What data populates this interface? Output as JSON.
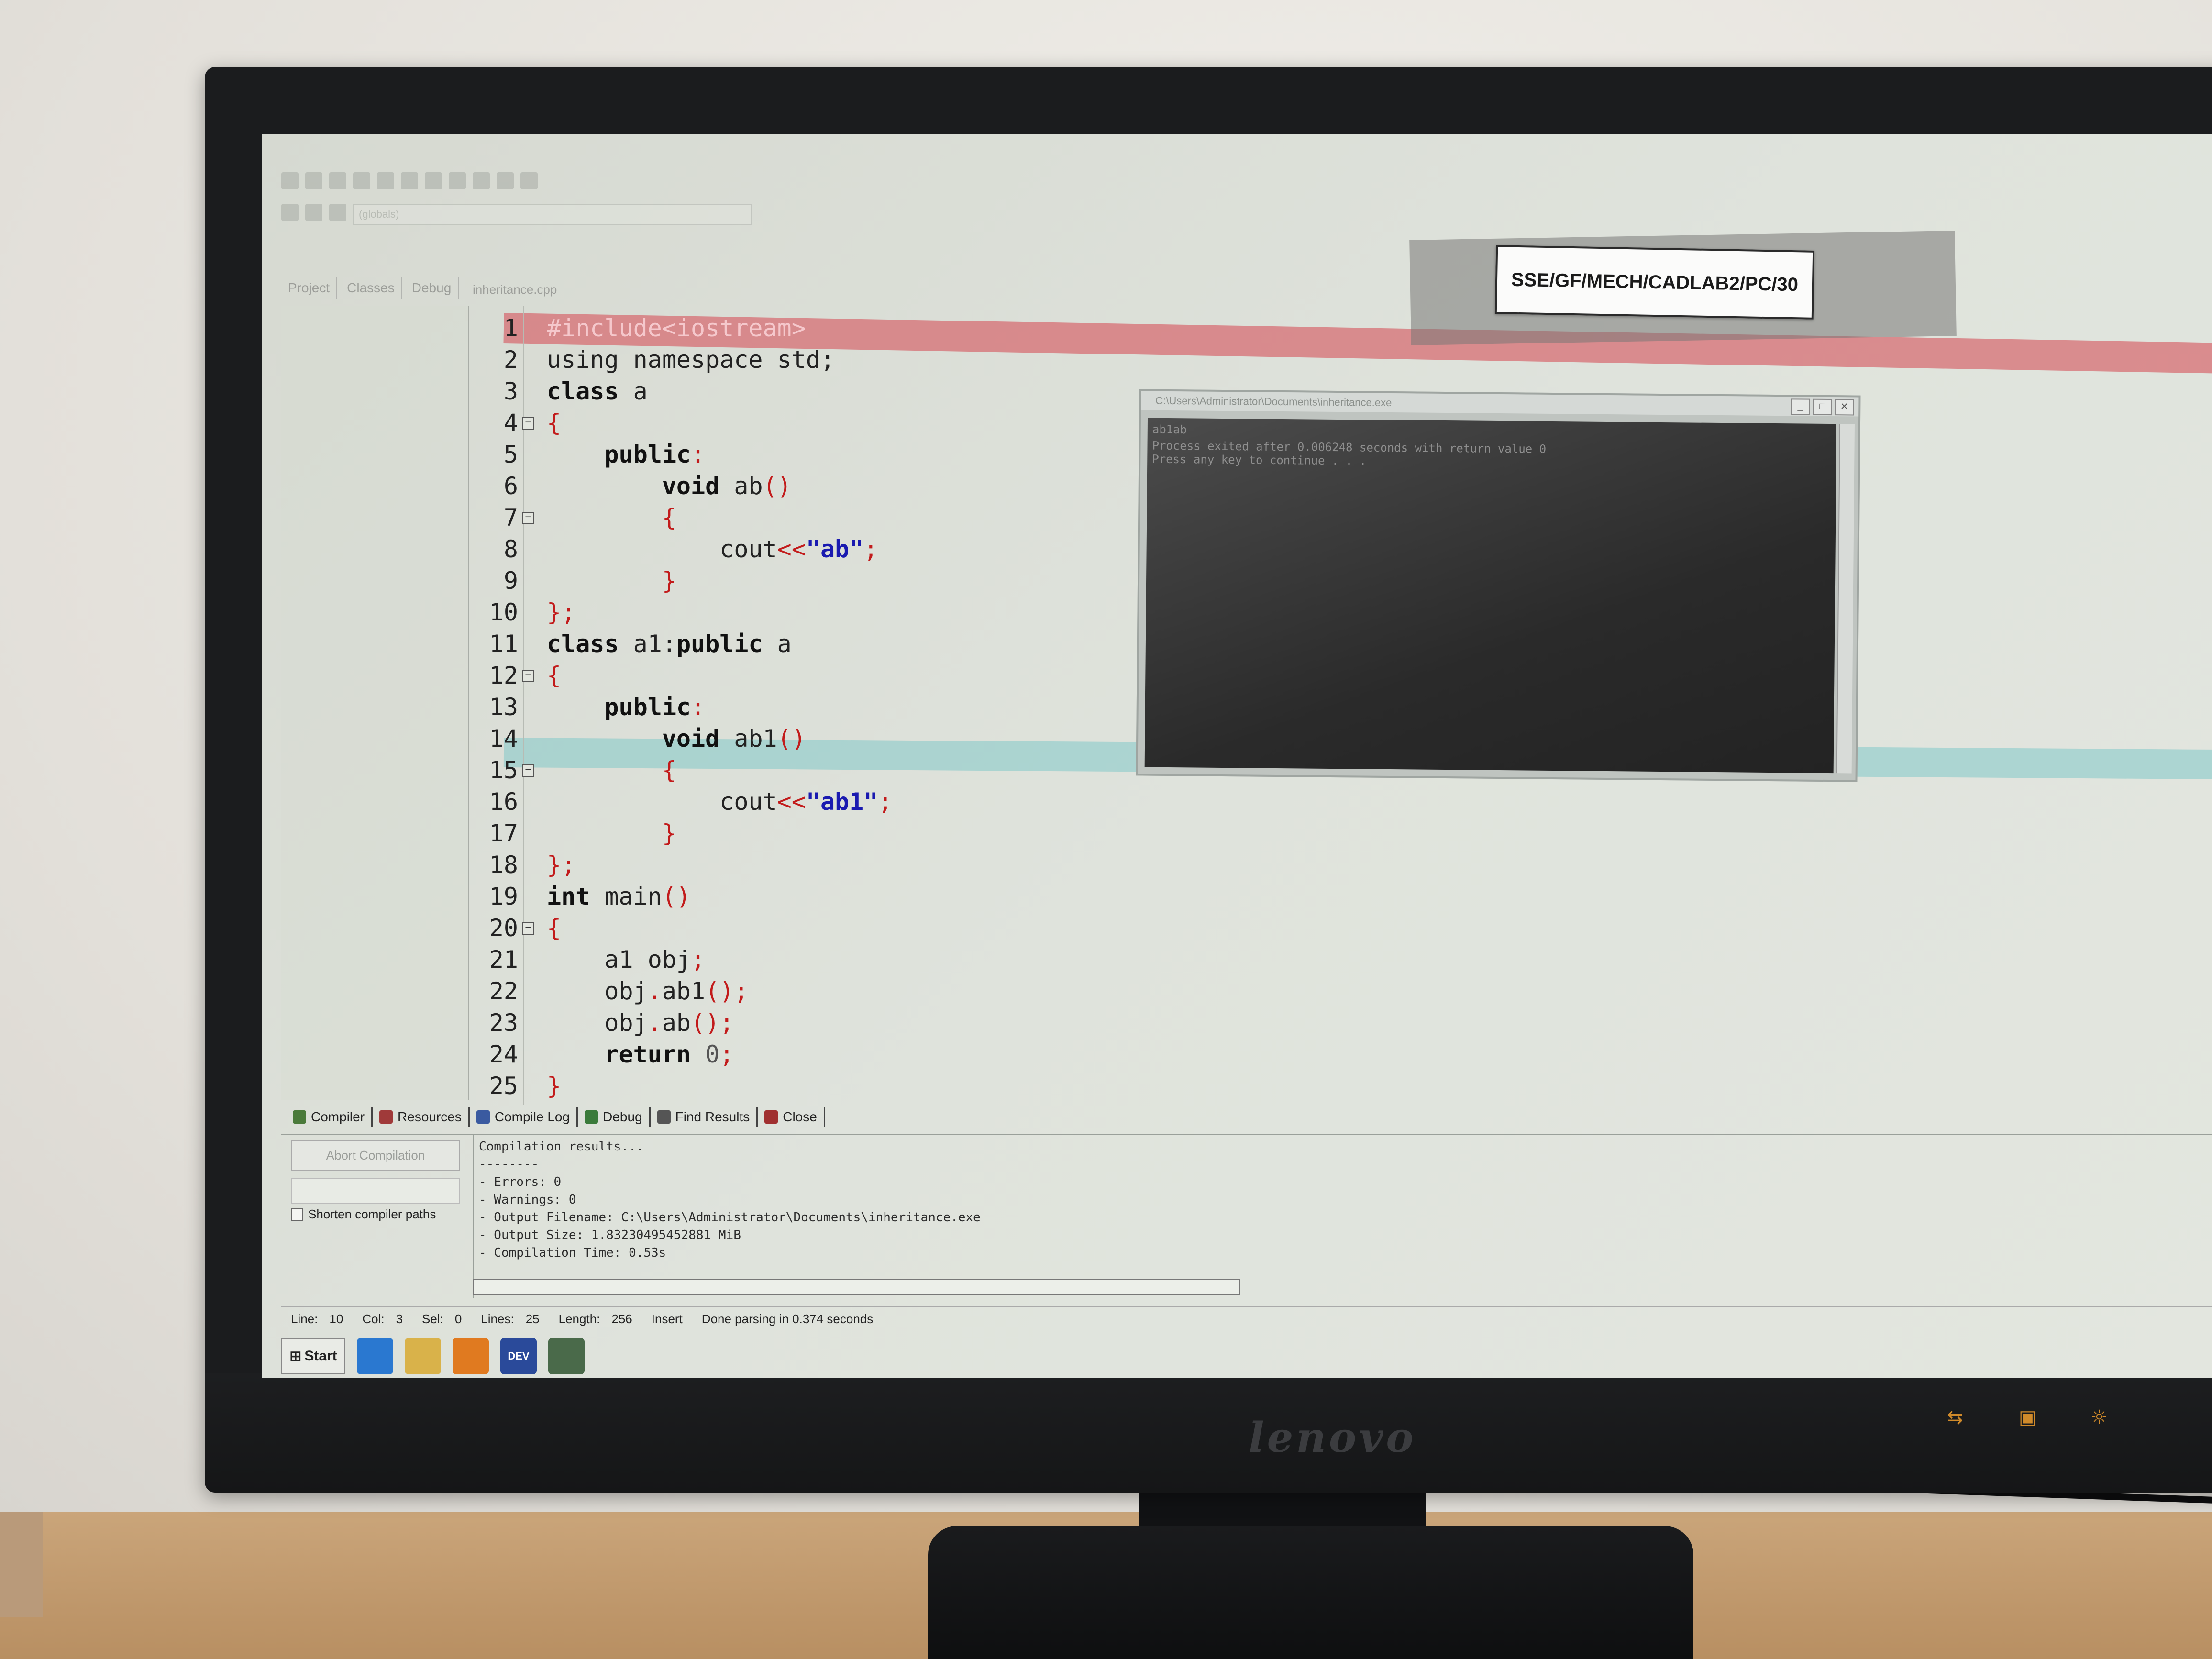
{
  "asset_label": "SSE/GF/MECH/CADLAB2/PC/30",
  "monitor_brand": "lenovo",
  "toolbar": {
    "combo_value": "(globals)"
  },
  "side_tabs": [
    "Project",
    "Classes",
    "Debug"
  ],
  "file_tab": "inheritance.cpp",
  "editor": {
    "lines": [
      {
        "n": "1",
        "segments": [
          {
            "t": "#include<iostream>",
            "c": "pre"
          }
        ]
      },
      {
        "n": "2",
        "segments": [
          {
            "t": "using namespace std;",
            "c": "plain"
          }
        ]
      },
      {
        "n": "3",
        "segments": [
          {
            "t": "class",
            "c": "kw"
          },
          {
            "t": " a",
            "c": "plain"
          }
        ]
      },
      {
        "n": "4",
        "segments": [
          {
            "t": "{",
            "c": "op"
          }
        ]
      },
      {
        "n": "5",
        "segments": [
          {
            "t": "    ",
            "c": "plain"
          },
          {
            "t": "public",
            "c": "kw"
          },
          {
            "t": ":",
            "c": "op"
          }
        ]
      },
      {
        "n": "6",
        "segments": [
          {
            "t": "        ",
            "c": "plain"
          },
          {
            "t": "void",
            "c": "kw"
          },
          {
            "t": " ab",
            "c": "plain"
          },
          {
            "t": "()",
            "c": "op"
          }
        ]
      },
      {
        "n": "7",
        "segments": [
          {
            "t": "        ",
            "c": "plain"
          },
          {
            "t": "{",
            "c": "op"
          }
        ]
      },
      {
        "n": "8",
        "segments": [
          {
            "t": "            cout",
            "c": "plain"
          },
          {
            "t": "<<",
            "c": "op"
          },
          {
            "t": "\"ab\"",
            "c": "str"
          },
          {
            "t": ";",
            "c": "op"
          }
        ]
      },
      {
        "n": "9",
        "segments": [
          {
            "t": "        ",
            "c": "plain"
          },
          {
            "t": "}",
            "c": "op"
          }
        ]
      },
      {
        "n": "10",
        "segments": [
          {
            "t": "};",
            "c": "op"
          }
        ]
      },
      {
        "n": "11",
        "segments": [
          {
            "t": "class",
            "c": "kw"
          },
          {
            "t": " a1:",
            "c": "plain"
          },
          {
            "t": "public",
            "c": "kw"
          },
          {
            "t": " a",
            "c": "plain"
          }
        ]
      },
      {
        "n": "12",
        "segments": [
          {
            "t": "{",
            "c": "op"
          }
        ]
      },
      {
        "n": "13",
        "segments": [
          {
            "t": "    ",
            "c": "plain"
          },
          {
            "t": "public",
            "c": "kw"
          },
          {
            "t": ":",
            "c": "op"
          }
        ]
      },
      {
        "n": "14",
        "segments": [
          {
            "t": "        ",
            "c": "plain"
          },
          {
            "t": "void",
            "c": "kw"
          },
          {
            "t": " ab1",
            "c": "plain"
          },
          {
            "t": "()",
            "c": "op"
          }
        ]
      },
      {
        "n": "15",
        "segments": [
          {
            "t": "        ",
            "c": "plain"
          },
          {
            "t": "{",
            "c": "op"
          }
        ]
      },
      {
        "n": "16",
        "segments": [
          {
            "t": "            cout",
            "c": "plain"
          },
          {
            "t": "<<",
            "c": "op"
          },
          {
            "t": "\"ab1\"",
            "c": "str"
          },
          {
            "t": ";",
            "c": "op"
          }
        ]
      },
      {
        "n": "17",
        "segments": [
          {
            "t": "        ",
            "c": "plain"
          },
          {
            "t": "}",
            "c": "op"
          }
        ]
      },
      {
        "n": "18",
        "segments": [
          {
            "t": "};",
            "c": "op"
          }
        ]
      },
      {
        "n": "19",
        "segments": [
          {
            "t": "int",
            "c": "kw"
          },
          {
            "t": " main",
            "c": "plain"
          },
          {
            "t": "()",
            "c": "op"
          }
        ]
      },
      {
        "n": "20",
        "segments": [
          {
            "t": "{",
            "c": "op"
          }
        ]
      },
      {
        "n": "21",
        "segments": [
          {
            "t": "    a1 obj",
            "c": "plain"
          },
          {
            "t": ";",
            "c": "op"
          }
        ]
      },
      {
        "n": "22",
        "segments": [
          {
            "t": "    obj",
            "c": "plain"
          },
          {
            "t": ".",
            "c": "op"
          },
          {
            "t": "ab1",
            "c": "plain"
          },
          {
            "t": "();",
            "c": "op"
          }
        ]
      },
      {
        "n": "23",
        "segments": [
          {
            "t": "    obj",
            "c": "plain"
          },
          {
            "t": ".",
            "c": "op"
          },
          {
            "t": "ab",
            "c": "plain"
          },
          {
            "t": "();",
            "c": "op"
          }
        ]
      },
      {
        "n": "24",
        "segments": [
          {
            "t": "    ",
            "c": "plain"
          },
          {
            "t": "return",
            "c": "kw"
          },
          {
            "t": " ",
            "c": "plain"
          },
          {
            "t": "0",
            "c": "num"
          },
          {
            "t": ";",
            "c": "op"
          }
        ]
      },
      {
        "n": "25",
        "segments": [
          {
            "t": "}",
            "c": "op"
          }
        ]
      }
    ],
    "fold_lines": [
      "4",
      "7",
      "12",
      "15",
      "20"
    ]
  },
  "console": {
    "title": "C:\\Users\\Administrator\\Documents\\inheritance.exe",
    "output": "ab1ab",
    "message_1": "Process exited after 0.006248 seconds with return value 0",
    "message_2": "Press any key to continue . . ."
  },
  "bottom_tabs": [
    {
      "label": "Compiler",
      "icon": "compiler-icon",
      "color": "#4a7a3a"
    },
    {
      "label": "Resources",
      "icon": "resources-icon",
      "color": "#a03a3a"
    },
    {
      "label": "Compile Log",
      "icon": "compile-log-icon",
      "color": "#3a5aa0"
    },
    {
      "label": "Debug",
      "icon": "debug-icon",
      "color": "#3a7a3a"
    },
    {
      "label": "Find Results",
      "icon": "find-results-icon",
      "color": "#555555"
    },
    {
      "label": "Close",
      "icon": "close-icon",
      "color": "#a03030"
    }
  ],
  "compile_panel": {
    "abort_label": "Abort Compilation",
    "shorten_label": "Shorten compiler paths",
    "log": [
      "Compilation results...",
      "--------",
      "- Errors: 0",
      "- Warnings: 0",
      "- Output Filename: C:\\Users\\Administrator\\Documents\\inheritance.exe",
      "- Output Size: 1.83230495452881 MiB",
      "- Compilation Time: 0.53s"
    ]
  },
  "status": {
    "line_label": "Line:",
    "line_value": "10",
    "col_label": "Col:",
    "col_value": "3",
    "sel_label": "Sel:",
    "sel_value": "0",
    "lines_label": "Lines:",
    "lines_value": "25",
    "length_label": "Length:",
    "length_value": "256",
    "mode": "Insert",
    "message": "Done parsing in 0.374 seconds"
  },
  "taskbar": {
    "start_label": "Start",
    "items": [
      {
        "icon": "ie-icon",
        "color": "#2a78d0"
      },
      {
        "icon": "folder-icon",
        "color": "#d9b24a"
      },
      {
        "icon": "media-player-icon",
        "color": "#e07a20"
      },
      {
        "icon": "devcpp-icon",
        "color": "#2a4a9a",
        "text": "DEV"
      },
      {
        "icon": "console-app-icon",
        "color": "#4a6a4a"
      }
    ]
  }
}
